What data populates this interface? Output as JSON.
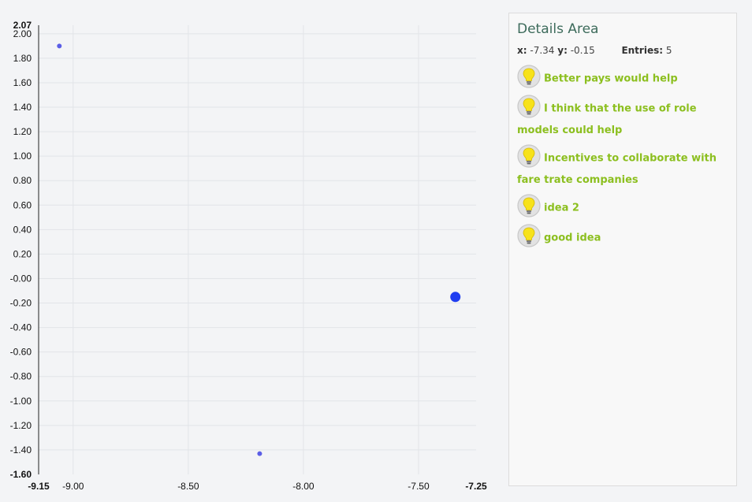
{
  "chart_data": {
    "type": "scatter",
    "xlim": [
      -9.15,
      -7.25
    ],
    "ylim": [
      -1.6,
      2.07
    ],
    "x_ticks": [
      "-9.00",
      "-8.50",
      "-8.00",
      "-7.50"
    ],
    "x_edge_labels": [
      "-9.15",
      "-7.25"
    ],
    "y_ticks": [
      "2.00",
      "1.80",
      "1.60",
      "1.40",
      "1.20",
      "1.00",
      "0.80",
      "0.60",
      "0.40",
      "0.20",
      "-0.00",
      "-0.20",
      "-0.40",
      "-0.60",
      "-0.80",
      "-1.00",
      "-1.20",
      "-1.40"
    ],
    "y_edge_labels": [
      "2.07",
      "-1.60"
    ],
    "grid": true,
    "points": [
      {
        "x": -9.06,
        "y": 1.9,
        "selected": false
      },
      {
        "x": -8.19,
        "y": -1.43,
        "selected": false
      },
      {
        "x": -7.34,
        "y": -0.15,
        "selected": true
      }
    ],
    "point_color": "#5b5ee6",
    "selected_color": "#1f3df0"
  },
  "details": {
    "title": "Details Area",
    "x_label": "x:",
    "x_value": "-7.34",
    "y_label": "y:",
    "y_value": "-0.15",
    "entries_label": "Entries:",
    "entries_value": "5",
    "entries": [
      {
        "text": "Better pays would help",
        "icon": "lightbulb-icon"
      },
      {
        "text": "I think that the use of role models could help",
        "icon": "lightbulb-icon"
      },
      {
        "text": "Incentives to collaborate with fare trate companies",
        "icon": "lightbulb-icon"
      },
      {
        "text": "idea 2",
        "icon": "lightbulb-icon"
      },
      {
        "text": "good idea",
        "icon": "lightbulb-icon"
      }
    ],
    "entry_color": "#8cbf1f"
  }
}
